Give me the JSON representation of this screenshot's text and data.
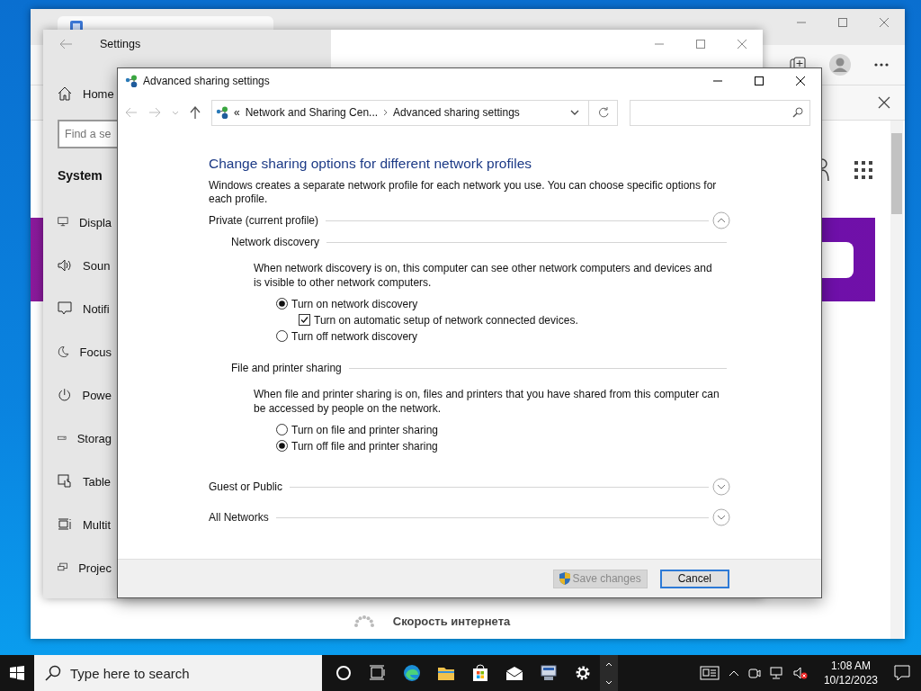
{
  "browser": {
    "footer_text": "Скорость интернета"
  },
  "settings": {
    "title": "Settings",
    "home": "Home",
    "search": {
      "placeholder": "Find a se"
    },
    "section": "System",
    "nav": [
      {
        "label": "Displa"
      },
      {
        "label": "Soun"
      },
      {
        "label": "Notifi"
      },
      {
        "label": "Focus"
      },
      {
        "label": "Powe"
      },
      {
        "label": "Storag"
      },
      {
        "label": "Table"
      },
      {
        "label": "Multit"
      },
      {
        "label": "Projec"
      }
    ]
  },
  "dialog": {
    "title": "Advanced sharing settings",
    "overflow": "«",
    "breadcrumb": [
      "Network and Sharing Cen...",
      "Advanced sharing settings"
    ],
    "heading": "Change sharing options for different network profiles",
    "intro": "Windows creates a separate network profile for each network you use. You can choose specific options for each profile.",
    "sections": [
      {
        "title": "Private (current profile)",
        "expanded": true,
        "groups": [
          {
            "title": "Network discovery",
            "description": "When network discovery is on, this computer can see other network computers and devices and is visible to other network computers.",
            "options": [
              {
                "kind": "radio",
                "label": "Turn on network discovery",
                "selected": true
              },
              {
                "kind": "checkbox",
                "label": "Turn on automatic setup of network connected devices.",
                "checked": true
              },
              {
                "kind": "radio",
                "label": "Turn off network discovery",
                "selected": false
              }
            ]
          },
          {
            "title": "File and printer sharing",
            "description": "When file and printer sharing is on, files and printers that you have shared from this computer can be accessed by people on the network.",
            "options": [
              {
                "kind": "radio",
                "label": "Turn on file and printer sharing",
                "selected": false
              },
              {
                "kind": "radio",
                "label": "Turn off file and printer sharing",
                "selected": true
              }
            ]
          }
        ]
      },
      {
        "title": "Guest or Public",
        "expanded": false
      },
      {
        "title": "All Networks",
        "expanded": false
      }
    ],
    "buttons": [
      {
        "label": "Save changes",
        "disabled": true,
        "default": false,
        "shield": true
      },
      {
        "label": "Cancel",
        "disabled": false,
        "default": true,
        "shield": false
      }
    ]
  },
  "taskbar": {
    "search": {
      "placeholder": "Type here to search"
    },
    "time": "1:08 AM",
    "date": "10/12/2023"
  }
}
